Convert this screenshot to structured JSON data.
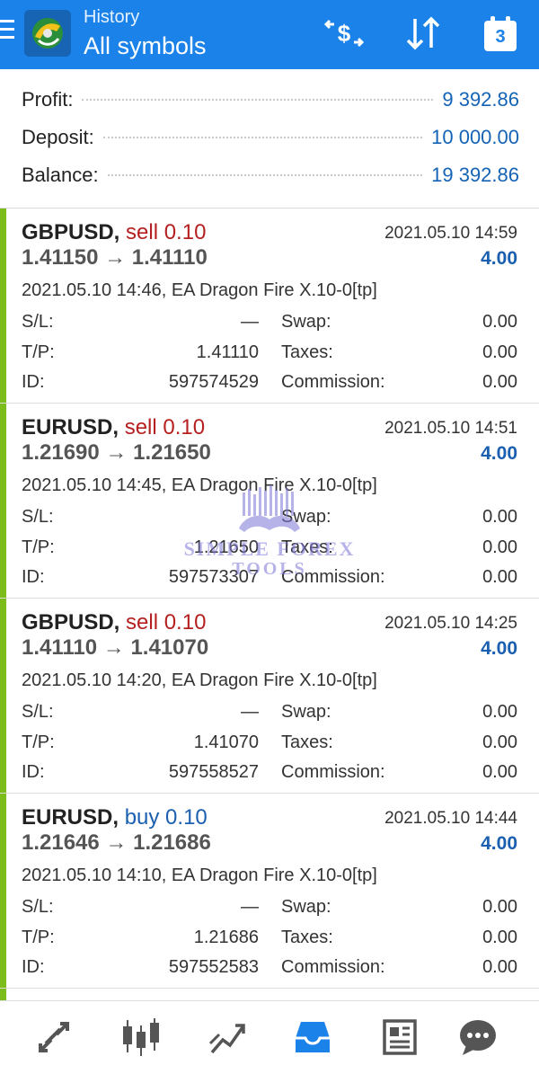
{
  "header": {
    "subtitle": "History",
    "title": "All symbols",
    "calendar_day": "3"
  },
  "icons": {
    "menu": "hamburger-menu-icon",
    "logo": "metatrader-logo",
    "currency": "currency-exchange-icon",
    "sort": "sort-arrows-icon",
    "calendar": "calendar-icon"
  },
  "summary": {
    "profit_label": "Profit:",
    "profit_value": "9 392.86",
    "deposit_label": "Deposit:",
    "deposit_value": "10 000.00",
    "balance_label": "Balance:",
    "balance_value": "19 392.86"
  },
  "deals": [
    {
      "symbol": "GBPUSD,",
      "type": "sell 0.10",
      "direction": "sell",
      "close_time": "2021.05.10 14:59",
      "prices": "1.41150 → 1.41110",
      "profit": "4.00",
      "comment": "2021.05.10 14:46, EA Dragon Fire X.10-0[tp]",
      "sl_label": "S/L:",
      "sl": "—",
      "swap_label": "Swap:",
      "swap": "0.00",
      "tp_label": "T/P:",
      "tp": "1.41110",
      "taxes_label": "Taxes:",
      "taxes": "0.00",
      "id_label": "ID:",
      "id": "597574529",
      "commission_label": "Commission:",
      "commission": "0.00"
    },
    {
      "symbol": "EURUSD,",
      "type": "sell 0.10",
      "direction": "sell",
      "close_time": "2021.05.10 14:51",
      "prices": "1.21690 → 1.21650",
      "profit": "4.00",
      "comment": "2021.05.10 14:45, EA Dragon Fire X.10-0[tp]",
      "sl_label": "S/L:",
      "sl": "",
      "swap_label": "Swap:",
      "swap": "0.00",
      "tp_label": "T/P:",
      "tp": "1.21650",
      "taxes_label": "Taxes:",
      "taxes": "0.00",
      "id_label": "ID:",
      "id": "597573307",
      "commission_label": "Commission:",
      "commission": "0.00"
    },
    {
      "symbol": "GBPUSD,",
      "type": "sell 0.10",
      "direction": "sell",
      "close_time": "2021.05.10 14:25",
      "prices": "1.41110 → 1.41070",
      "profit": "4.00",
      "comment": "2021.05.10 14:20, EA Dragon Fire X.10-0[tp]",
      "sl_label": "S/L:",
      "sl": "—",
      "swap_label": "Swap:",
      "swap": "0.00",
      "tp_label": "T/P:",
      "tp": "1.41070",
      "taxes_label": "Taxes:",
      "taxes": "0.00",
      "id_label": "ID:",
      "id": "597558527",
      "commission_label": "Commission:",
      "commission": "0.00"
    },
    {
      "symbol": "EURUSD,",
      "type": "buy 0.10",
      "direction": "buy",
      "close_time": "2021.05.10 14:44",
      "prices": "1.21646 → 1.21686",
      "profit": "4.00",
      "comment": "2021.05.10 14:10, EA Dragon Fire X.10-0[tp]",
      "sl_label": "S/L:",
      "sl": "—",
      "swap_label": "Swap:",
      "swap": "0.00",
      "tp_label": "T/P:",
      "tp": "1.21686",
      "taxes_label": "Taxes:",
      "taxes": "0.00",
      "id_label": "ID:",
      "id": "597552583",
      "commission_label": "Commission:",
      "commission": "0.00"
    }
  ],
  "watermark": {
    "line1": "SIMPLE FOREX",
    "line2": "TOOLS"
  },
  "bottom_nav": [
    {
      "name": "nav-quotes",
      "icon": "arrows-quotes-icon",
      "active": false
    },
    {
      "name": "nav-chart",
      "icon": "candlestick-chart-icon",
      "active": false
    },
    {
      "name": "nav-trade",
      "icon": "trade-trend-icon",
      "active": false
    },
    {
      "name": "nav-history",
      "icon": "inbox-history-icon",
      "active": true
    },
    {
      "name": "nav-news",
      "icon": "news-icon",
      "active": false
    },
    {
      "name": "nav-messages",
      "icon": "chat-bubble-icon",
      "active": false
    }
  ],
  "colors": {
    "header_bg": "#1a82e8",
    "profit_blue": "#1463b5",
    "sell_red": "#b52020",
    "buy_blue": "#1a5fb0",
    "deal_bar_green": "#7cbd1c",
    "active_nav": "#1a82e8"
  }
}
